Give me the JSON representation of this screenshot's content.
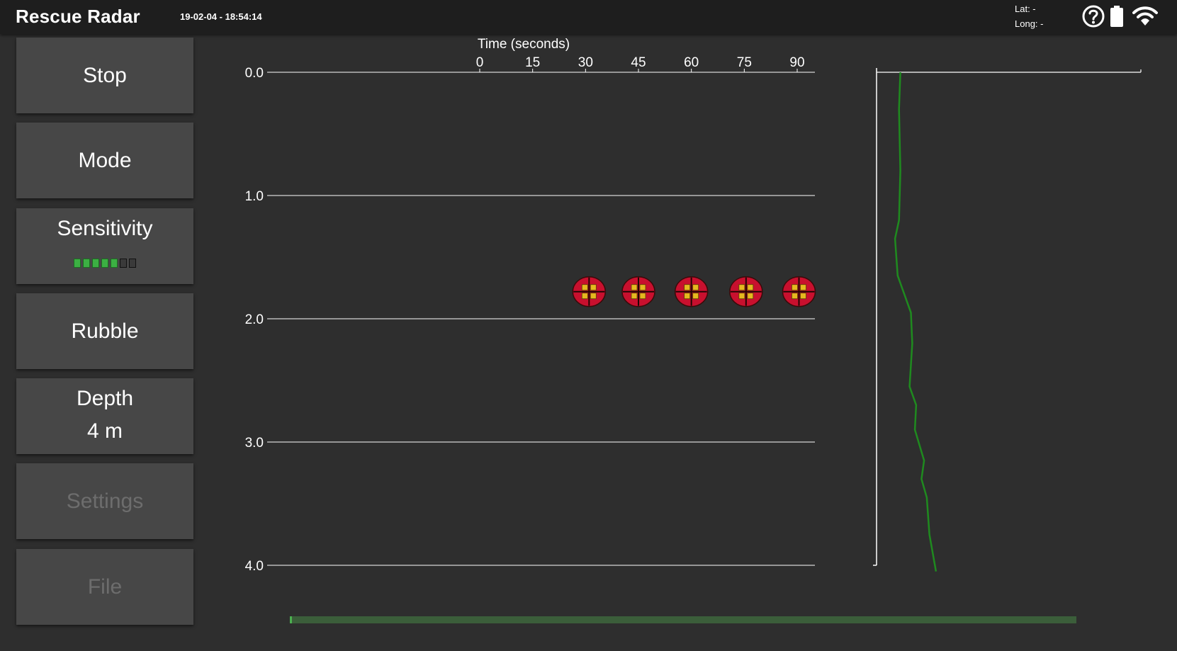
{
  "header": {
    "title": "Rescue Radar",
    "datetime": "19-02-04 - 18:54:14",
    "gps": {
      "lat": "Lat: -",
      "long": "Long: -"
    },
    "icons": [
      "help-icon",
      "battery-icon",
      "wifi-icon"
    ]
  },
  "sidebar": {
    "stop": "Stop",
    "mode": "Mode",
    "sensitivity": {
      "label": "Sensitivity",
      "level": 5,
      "max": 7
    },
    "rubble": "Rubble",
    "depth": {
      "label": "Depth",
      "value": "4 m"
    },
    "settings": "Settings",
    "file": "File"
  },
  "colors": {
    "background": "#2e2e2e",
    "topbar": "#1e1e1e",
    "button": "#474747",
    "disabled_text": "#6d6d6d",
    "active_green": "#3cb043",
    "signal_line": "#1f8a1f",
    "marker_red": "#c8102e",
    "marker_yellow": "#e6b820",
    "progress": "#3b5e3a"
  },
  "chart_data": [
    {
      "type": "scatter",
      "title": "",
      "xlabel": "Time (seconds)",
      "ylabel": "",
      "x_ticks": [
        0,
        15,
        30,
        45,
        60,
        75,
        90
      ],
      "y_ticks": [
        "0.0",
        "1.0",
        "2.0",
        "3.0",
        "4.0"
      ],
      "xlim": [
        0,
        90
      ],
      "ylim": [
        0,
        4
      ],
      "grid": true,
      "markers": [
        {
          "x": 31,
          "y": 1.78
        },
        {
          "x": 45,
          "y": 1.78
        },
        {
          "x": 60,
          "y": 1.78
        },
        {
          "x": 75.5,
          "y": 1.78
        },
        {
          "x": 90.5,
          "y": 1.78
        }
      ]
    },
    {
      "type": "line",
      "title": "",
      "ylim": [
        0,
        4
      ],
      "series": [
        {
          "points": [
            {
              "x": 0.09,
              "y": 0.0
            },
            {
              "x": 0.085,
              "y": 0.3
            },
            {
              "x": 0.09,
              "y": 0.8
            },
            {
              "x": 0.085,
              "y": 1.2
            },
            {
              "x": 0.07,
              "y": 1.35
            },
            {
              "x": 0.08,
              "y": 1.65
            },
            {
              "x": 0.13,
              "y": 1.95
            },
            {
              "x": 0.135,
              "y": 2.2
            },
            {
              "x": 0.125,
              "y": 2.55
            },
            {
              "x": 0.15,
              "y": 2.7
            },
            {
              "x": 0.145,
              "y": 2.9
            },
            {
              "x": 0.18,
              "y": 3.15
            },
            {
              "x": 0.17,
              "y": 3.3
            },
            {
              "x": 0.19,
              "y": 3.45
            },
            {
              "x": 0.2,
              "y": 3.75
            },
            {
              "x": 0.225,
              "y": 4.05
            }
          ]
        }
      ]
    }
  ],
  "progress": {
    "fraction": 1.0
  }
}
